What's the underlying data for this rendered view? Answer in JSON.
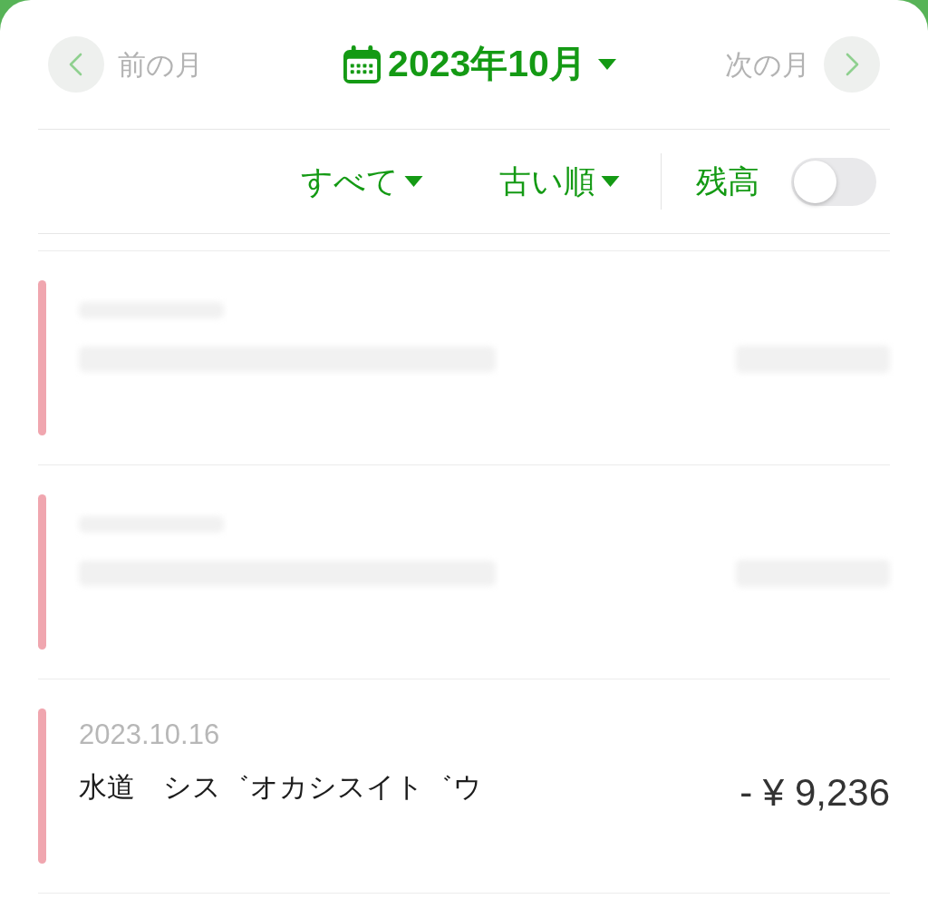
{
  "header": {
    "prev_label": "前の月",
    "title": "2023年10月",
    "next_label": "次の月"
  },
  "filters": [
    {
      "label": "すべて"
    },
    {
      "label": "古い順"
    }
  ],
  "balance_toggle": {
    "label": "残高",
    "on": false
  },
  "transactions": [
    {
      "kind": "redacted"
    },
    {
      "kind": "redacted"
    },
    {
      "kind": "visible",
      "date": "2023.10.16",
      "description": "水道　シス゛オカシスイト゛ウ",
      "amount": "- ¥ 9,236"
    }
  ]
}
